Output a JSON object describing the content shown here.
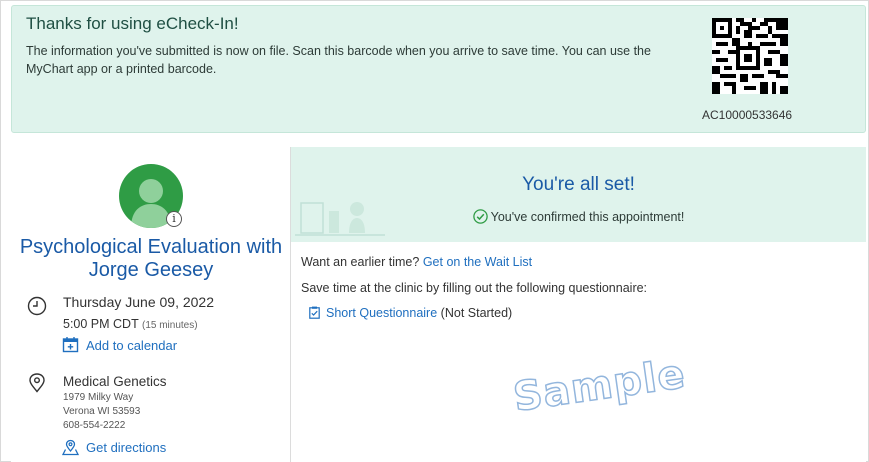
{
  "banner": {
    "title": "Thanks for using eCheck-In!",
    "text": "The information you've submitted is now on file. Scan this barcode when you arrive to save time. You can use the MyChart app or a printed barcode.",
    "barcode_id": "AC10000533646"
  },
  "appointment": {
    "title": "Psychological Evaluation with Jorge Geesey",
    "date": "Thursday June 09, 2022",
    "time": "5:00 PM CDT",
    "duration": "(15 minutes)",
    "add_calendar": "Add to calendar",
    "location": {
      "name": "Medical Genetics",
      "address1": "1979 Milky Way",
      "address2": "Verona WI 53593",
      "phone": "608-554-2222"
    },
    "directions": "Get directions"
  },
  "status": {
    "title": "You're all set!",
    "confirm": "You've confirmed this appointment!"
  },
  "actions": {
    "earlier": "Want an earlier time?",
    "waitlist": "Get on the Wait List",
    "questionnaire_intro": "Save time at the clinic by filling out the following questionnaire:",
    "questionnaire": "Short Questionnaire",
    "questionnaire_status": "(Not Started)"
  },
  "watermark": "Sample",
  "colors": {
    "accent_bg": "#dff3ec",
    "link": "#1f6fbf",
    "heading": "#1a5aa6",
    "avatar": "#2f9c45",
    "check": "#2f9c45"
  },
  "icons": [
    "clock-icon",
    "calendar-add-icon",
    "location-pin-icon",
    "directions-icon",
    "check-circle-icon",
    "clipboard-icon",
    "info-icon"
  ]
}
